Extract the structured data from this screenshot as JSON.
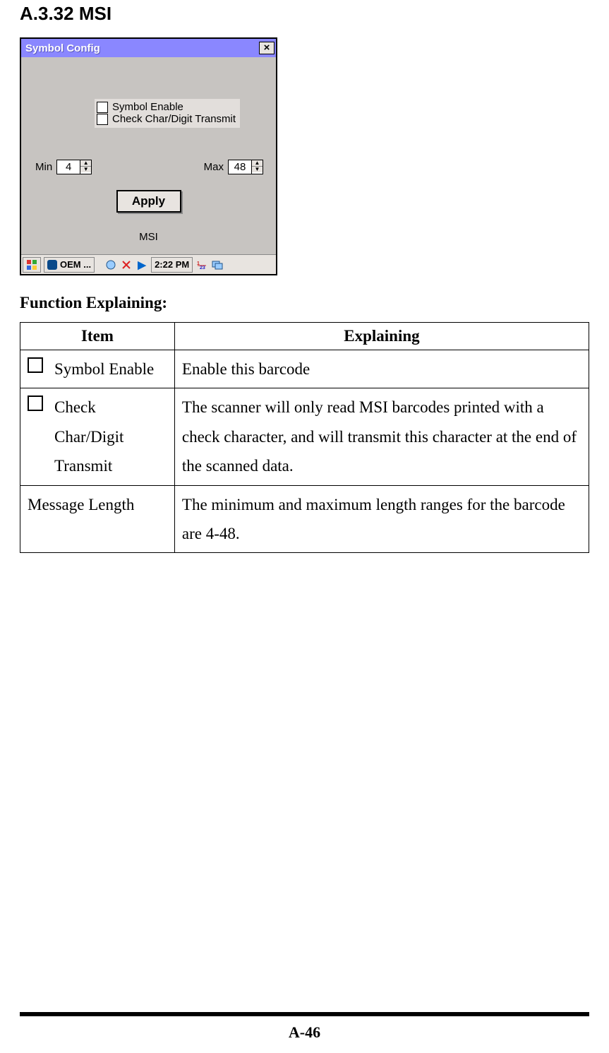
{
  "heading": "A.3.32 MSI",
  "dialog": {
    "title": "Symbol Config",
    "checks": [
      {
        "label": "Symbol Enable"
      },
      {
        "label": "Check Char/Digit Transmit"
      }
    ],
    "min_label": "Min",
    "min_value": "4",
    "max_label": "Max",
    "max_value": "48",
    "apply_label": "Apply",
    "mode_name": "MSI"
  },
  "taskbar": {
    "oem_label": "OEM ...",
    "clock": "2:22 PM"
  },
  "function_heading": "Function Explaining:",
  "table": {
    "headers": {
      "item": "Item",
      "explaining": "Explaining"
    },
    "rows": [
      {
        "has_checkbox": true,
        "item": "Symbol Enable",
        "explain": "Enable this barcode"
      },
      {
        "has_checkbox": true,
        "item": "Check Char/Digit Transmit",
        "explain": "The scanner will only read MSI barcodes printed with a check character, and will transmit this character at the end of the scanned data."
      },
      {
        "has_checkbox": false,
        "item": "Message Length",
        "explain": "The minimum and maximum length ranges for the barcode are 4-48."
      }
    ]
  },
  "page_number": "A-46"
}
